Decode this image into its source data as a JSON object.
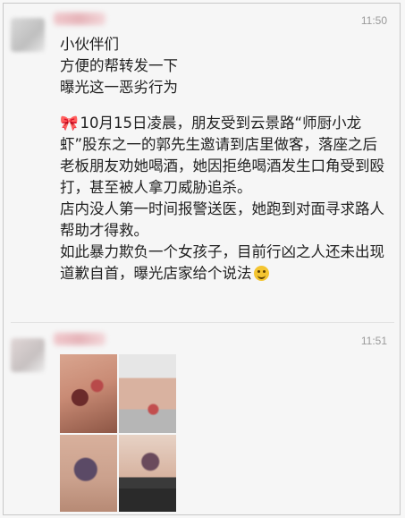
{
  "posts": [
    {
      "time": "11:50",
      "lines": [
        "小伙伴们",
        "方便的帮转发一下",
        "曝光这一恶劣行为"
      ],
      "bow_icon": "🎀",
      "paragraph1": "10月15日凌晨，朋友受到云景路“师厨小龙虾”股东之一的郭先生邀请到店里做客，落座之后老板朋友劝她喝酒，她因拒绝喝酒发生口角受到殴打，甚至被人拿刀威胁追杀。",
      "paragraph2": "店内没人第一时间报警送医，她跑到对面寻求路人帮助才得救。",
      "paragraph3": "如此暴力欺负一个女孩子，目前行凶之人还未出现道歉自首，曝光店家给个说法",
      "emoji_icon": "smiling-face-icon"
    },
    {
      "time": "11:51",
      "photos": [
        "photo-1",
        "photo-2",
        "photo-3",
        "photo-4"
      ]
    }
  ]
}
